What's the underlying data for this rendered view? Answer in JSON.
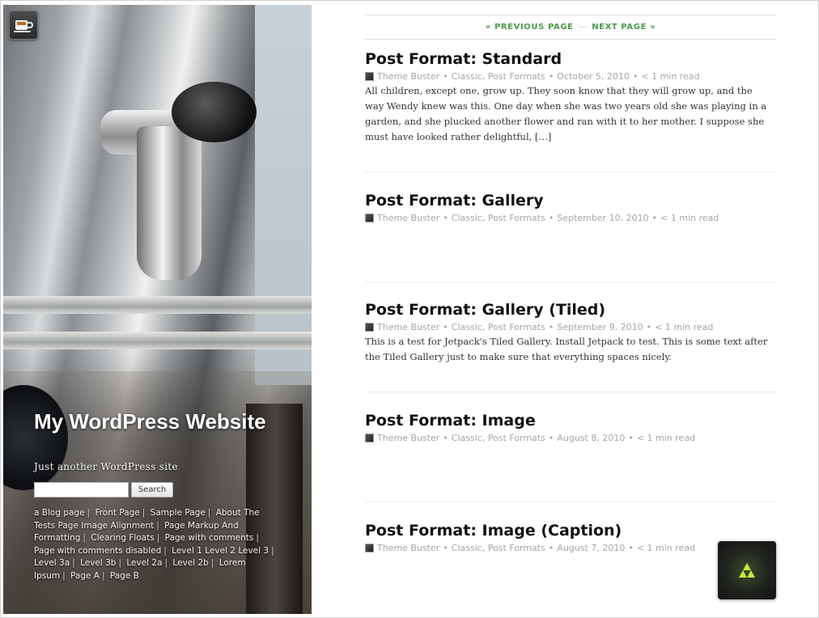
{
  "site": {
    "title": "My WordPress Website",
    "description": "Just another WordPress site",
    "search_button": "Search",
    "search_placeholder": ""
  },
  "menu": [
    "a Blog page",
    "Front Page",
    "Sample Page",
    "About The Tests",
    "Page Image Alignment",
    "Page Markup And Formatting",
    "Clearing Floats",
    "Page with comments",
    "Page with comments disabled",
    "Level 1",
    "Level 2",
    "Level 3",
    "Level 3a",
    "Level 3b",
    "Level 2a",
    "Level 2b",
    "Lorem Ipsum",
    "Page A",
    "Page B"
  ],
  "pager": {
    "previous": "« PREVIOUS PAGE",
    "separator": "—",
    "next": "NEXT PAGE »"
  },
  "meta_separator": "•",
  "posts": [
    {
      "title": "Post Format: Standard",
      "author": "Theme Buster",
      "categories": "Classic, Post Formats",
      "date": "October 5, 2010",
      "read_time": "< 1 min read",
      "excerpt": "All children, except one, grow up. They soon know that they will grow up, and the way Wendy knew was this. One day when she was two years old she was playing in a garden, and she plucked another flower and ran with it to her mother. I suppose she must have looked rather delightful, […]"
    },
    {
      "title": "Post Format: Gallery",
      "author": "Theme Buster",
      "categories": "Classic, Post Formats",
      "date": "September 10, 2010",
      "read_time": "< 1 min read",
      "excerpt": ""
    },
    {
      "title": "Post Format: Gallery (Tiled)",
      "author": "Theme Buster",
      "categories": "Classic, Post Formats",
      "date": "September 9, 2010",
      "read_time": "< 1 min read",
      "excerpt": "This is a test for Jetpack's Tiled Gallery. Install Jetpack to test. This is some text after the Tiled Gallery just to make sure that everything spaces nicely."
    },
    {
      "title": "Post Format: Image",
      "author": "Theme Buster",
      "categories": "Classic, Post Formats",
      "date": "August 8, 2010",
      "read_time": "< 1 min read",
      "excerpt": ""
    },
    {
      "title": "Post Format: Image (Caption)",
      "author": "Theme Buster",
      "categories": "Classic, Post Formats",
      "date": "August 7, 2010",
      "read_time": "< 1 min read",
      "excerpt": ""
    }
  ],
  "icons": {
    "logo": "coffee-cup-icon",
    "floating_button": "triforce-icon",
    "author": "author-avatar-icon"
  },
  "colors": {
    "accent": "#4a9a4a",
    "title": "#111111",
    "meta": "#a6a6a6",
    "fab_glow": "#b8e03a"
  }
}
